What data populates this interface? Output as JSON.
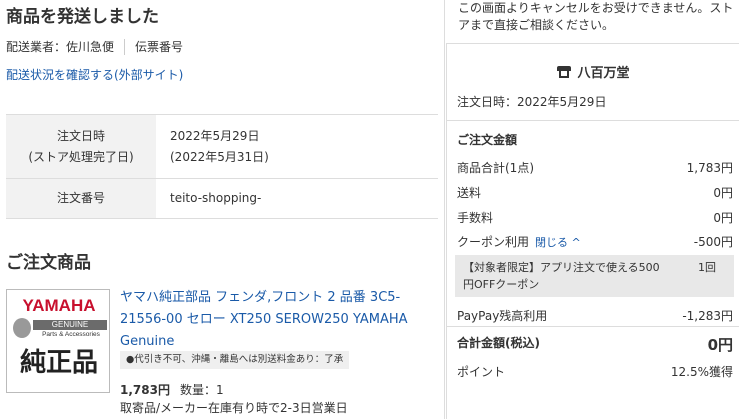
{
  "shipment": {
    "title": "商品を発送しました",
    "carrier": "配送業者：佐川急便",
    "tracking_number_label": "伝票番号",
    "tracking_link": "配送状況を確認する(外部サイト)"
  },
  "order_info": {
    "date_label_1": "注文日時",
    "date_label_2": "(ストア処理完了日)",
    "date_value_1": "2022年5月29日",
    "date_value_2": "(2022年5月31日)",
    "number_label": "注文番号",
    "number_value": "teito-shopping-"
  },
  "products_section": {
    "title": "ご注文商品",
    "product": {
      "image_brand": "YAMAHA",
      "image_genuine": "GENUINE",
      "image_parts": "Parts & Accessories",
      "image_big": "純正品",
      "name": "ヤマハ純正部品 フェンダ,フロント 2 品番 3C5-21556-00 セロー XT250 SEROW250 YAMAHA Genuine",
      "note": "●代引き不可、沖縄・離島へは別送料金あり：了承",
      "price": "1,783円",
      "quantity": "数量：1",
      "delivery": "取寄品/メーカー在庫有り時で2-3日営業日"
    }
  },
  "sidebar": {
    "cancel_note": "この画面よりキャンセルをお受けできません。ストアまで直接ご相談ください。",
    "store_name": "八百万堂",
    "order_date": "注文日時：2022年5月29日",
    "amount_title": "ご注文金額",
    "subtotal_label": "商品合計(1点)",
    "subtotal_value": "1,783円",
    "shipping_label": "送料",
    "shipping_value": "0円",
    "fee_label": "手数料",
    "fee_value": "0円",
    "coupon_label": "クーポン利用",
    "coupon_toggle": "閉じる ^",
    "coupon_value": "-500円",
    "coupon_detail": "【対象者限定】アプリ注文で使える500円OFFクーポン",
    "coupon_count": "1回",
    "paypay_label": "PayPay残高利用",
    "paypay_value": "-1,283円",
    "total_label": "合計金額(税込)",
    "total_value": "0円",
    "points_label": "ポイント",
    "points_value": "12.5%獲得"
  }
}
